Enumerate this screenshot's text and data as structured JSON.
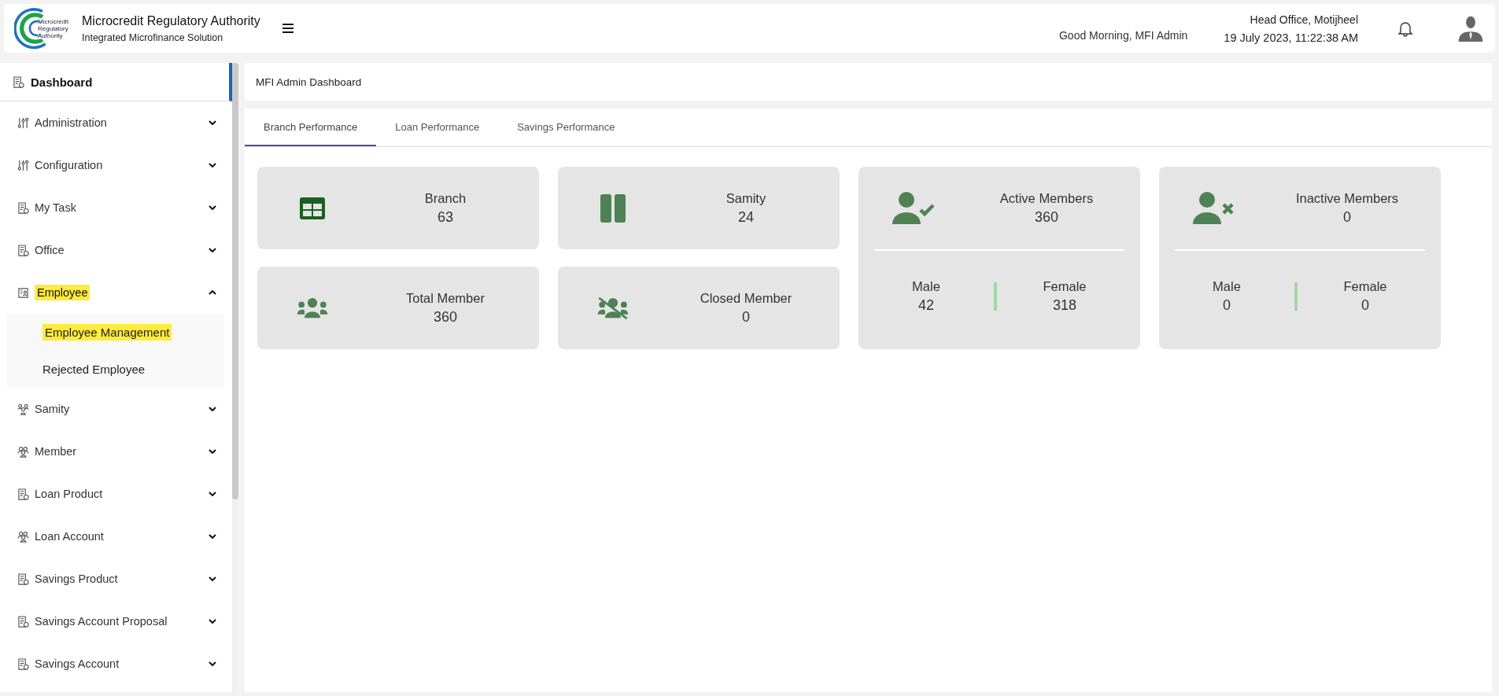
{
  "header": {
    "logo_text": "Microcredit Regulatory Authority",
    "title": "Microcredit Regulatory Authority",
    "subtitle": "Integrated Microfinance Solution",
    "greeting": "Good Morning, MFI Admin",
    "office": "Head Office, Motijheel",
    "datetime": "19 July 2023, 11:22:38 AM"
  },
  "sidebar": {
    "dashboard": {
      "label": "Dashboard"
    },
    "items": [
      {
        "label": "Administration",
        "kind": "sliders",
        "expanded": false,
        "highlighted": false
      },
      {
        "label": "Configuration",
        "kind": "sliders",
        "expanded": false,
        "highlighted": false
      },
      {
        "label": "My Task",
        "kind": "document",
        "expanded": false,
        "highlighted": false
      },
      {
        "label": "Office",
        "kind": "document",
        "expanded": false,
        "highlighted": false
      },
      {
        "label": "Employee",
        "kind": "badge",
        "expanded": true,
        "highlighted": true,
        "children": [
          {
            "label": "Employee Management",
            "highlighted": true
          },
          {
            "label": "Rejected Employee",
            "highlighted": false
          }
        ]
      },
      {
        "label": "Samity",
        "kind": "group",
        "expanded": false,
        "highlighted": false
      },
      {
        "label": "Member",
        "kind": "people",
        "expanded": false,
        "highlighted": false
      },
      {
        "label": "Loan Product",
        "kind": "document",
        "expanded": false,
        "highlighted": false
      },
      {
        "label": "Loan Account",
        "kind": "people",
        "expanded": false,
        "highlighted": false
      },
      {
        "label": "Savings Product",
        "kind": "document",
        "expanded": false,
        "highlighted": false
      },
      {
        "label": "Savings Account Proposal",
        "kind": "document",
        "expanded": false,
        "highlighted": false
      },
      {
        "label": "Savings Account",
        "kind": "document",
        "expanded": false,
        "highlighted": false
      }
    ]
  },
  "breadcrumb": "MFI Admin Dashboard",
  "tabs": [
    {
      "label": "Branch Performance",
      "selected": true
    },
    {
      "label": "Loan Performance",
      "selected": false
    },
    {
      "label": "Savings Performance",
      "selected": false
    }
  ],
  "cards": [
    {
      "kind": "stat",
      "label": "Branch",
      "value": "63"
    },
    {
      "kind": "stat",
      "label": "Samity",
      "value": "24"
    },
    {
      "kind": "split",
      "label": "Active Members",
      "value": "360",
      "left_label": "Male",
      "left_value": "42",
      "right_label": "Female",
      "right_value": "318"
    },
    {
      "kind": "split",
      "label": "Inactive Members",
      "value": "0",
      "left_label": "Male",
      "left_value": "0",
      "right_label": "Female",
      "right_value": "0"
    },
    {
      "kind": "stat",
      "label": "Total Member",
      "value": "360"
    },
    {
      "kind": "stat",
      "label": "Closed Member",
      "value": "0"
    }
  ]
}
